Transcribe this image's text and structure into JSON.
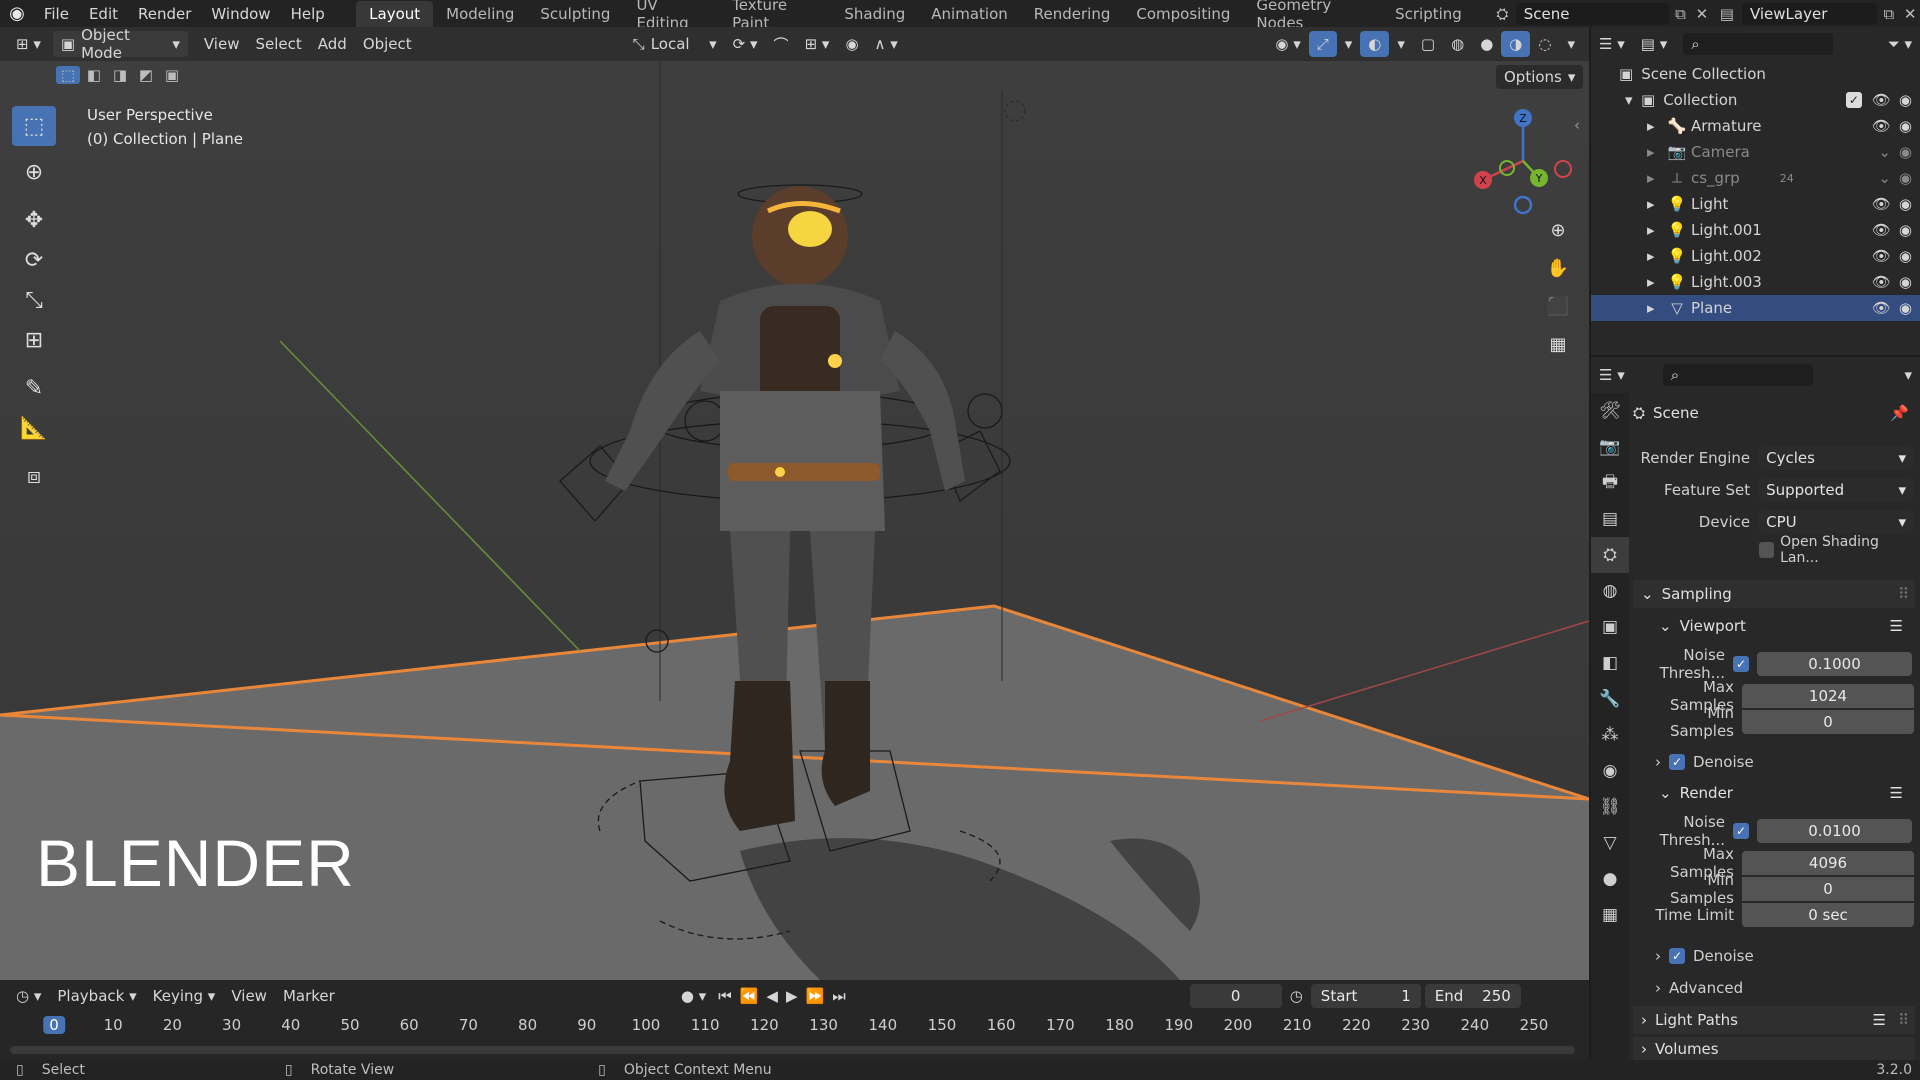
{
  "menu": [
    "File",
    "Edit",
    "Render",
    "Window",
    "Help"
  ],
  "workspaces": [
    "Layout",
    "Modeling",
    "Sculpting",
    "UV Editing",
    "Texture Paint",
    "Shading",
    "Animation",
    "Rendering",
    "Compositing",
    "Geometry Nodes",
    "Scripting"
  ],
  "active_workspace": "Layout",
  "scene_name": "Scene",
  "view_layer": "ViewLayer",
  "viewport_header": {
    "mode": "Object Mode",
    "menus": [
      "View",
      "Select",
      "Add",
      "Object"
    ],
    "orientation": "Local",
    "options": "Options"
  },
  "viewport": {
    "perspective": "User Perspective",
    "context": "(0) Collection | Plane",
    "watermark": "BLENDER",
    "gizmo_axes": [
      "X",
      "Y",
      "Z"
    ]
  },
  "outliner": {
    "root": "Scene Collection",
    "collection": "Collection",
    "items": [
      {
        "name": "Armature",
        "extra": ""
      },
      {
        "name": "Camera",
        "extra": ""
      },
      {
        "name": "cs_grp",
        "extra": "24"
      },
      {
        "name": "Light",
        "extra": ""
      },
      {
        "name": "Light.001",
        "extra": ""
      },
      {
        "name": "Light.002",
        "extra": ""
      },
      {
        "name": "Light.003",
        "extra": ""
      },
      {
        "name": "Plane",
        "extra": ""
      }
    ],
    "selected": "Plane"
  },
  "properties": {
    "context": "Scene",
    "render_engine_label": "Render Engine",
    "render_engine": "Cycles",
    "feature_set_label": "Feature Set",
    "feature_set": "Supported",
    "device_label": "Device",
    "device": "CPU",
    "osl_label": "Open Shading Lan...",
    "sampling": "Sampling",
    "viewport_section": "Viewport",
    "viewport_noise_label": "Noise Thresh...",
    "viewport_noise": "0.1000",
    "viewport_max_label": "Max Samples",
    "viewport_max": "1024",
    "viewport_min_label": "Min Samples",
    "viewport_min": "0",
    "denoise_label": "Denoise",
    "render_section": "Render",
    "render_noise_label": "Noise Thresh...",
    "render_noise": "0.0100",
    "render_max_label": "Max Samples",
    "render_max": "4096",
    "render_min_label": "Min Samples",
    "render_min": "0",
    "time_limit_label": "Time Limit",
    "time_limit": "0 sec",
    "render_denoise_label": "Denoise",
    "advanced": "Advanced",
    "light_paths": "Light Paths",
    "volumes": "Volumes"
  },
  "timeline": {
    "menus": [
      "Playback",
      "Keying",
      "View",
      "Marker"
    ],
    "current_frame": "0",
    "start_label": "Start",
    "start": "1",
    "end_label": "End",
    "end": "250",
    "ticks": [
      "0",
      "10",
      "20",
      "30",
      "40",
      "50",
      "60",
      "70",
      "80",
      "90",
      "100",
      "110",
      "120",
      "130",
      "140",
      "150",
      "160",
      "170",
      "180",
      "190",
      "200",
      "210",
      "220",
      "230",
      "240",
      "250"
    ]
  },
  "statusbar": {
    "select": "Select",
    "rotate": "Rotate View",
    "context_menu": "Object Context Menu",
    "version": "3.2.0"
  }
}
